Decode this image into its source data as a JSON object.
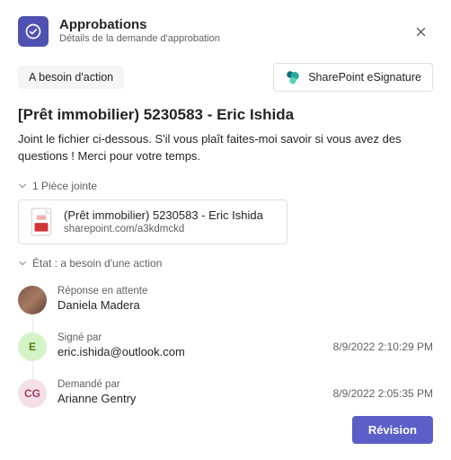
{
  "header": {
    "title": "Approbations",
    "subtitle": "Détails de la demande d'approbation"
  },
  "status_chip": "A besoin d'action",
  "provider": {
    "label": "SharePoint eSignature"
  },
  "request": {
    "title": "[Prêt immobilier) 5230583 - Eric Ishida",
    "description": "Joint le fichier ci-dessous. S'il vous plaît faites-moi savoir si vous avez des questions ! Merci pour votre temps."
  },
  "attachments": {
    "section_label": "1 Pièce jointe",
    "items": [
      {
        "name": "(Prêt immobilier) 5230583 - Eric Ishida",
        "link": "sharepoint.com/a3kdmckd"
      }
    ]
  },
  "state": {
    "section_label": "État : a besoin d'une action",
    "entries": [
      {
        "avatar_type": "img",
        "avatar_text": "",
        "label": "Réponse en attente",
        "name": "Daniela Madera",
        "timestamp": ""
      },
      {
        "avatar_type": "e",
        "avatar_text": "E",
        "label": "Signé par",
        "name": "eric.ishida@outlook.com",
        "timestamp": "8/9/2022 2:10:29 PM"
      },
      {
        "avatar_type": "cg",
        "avatar_text": "CG",
        "label": "Demandé par",
        "name": "Arianne Gentry",
        "timestamp": "8/9/2022 2:05:35 PM"
      }
    ]
  },
  "footer": {
    "primary": "Révision"
  }
}
